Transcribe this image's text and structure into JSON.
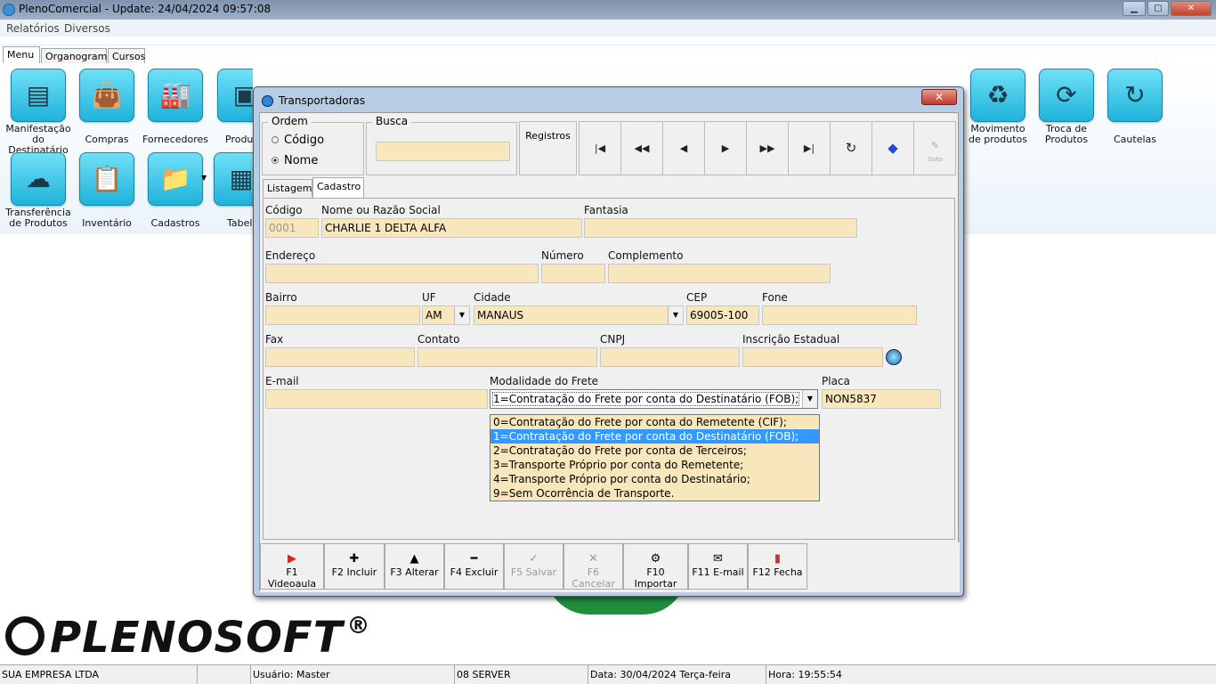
{
  "window": {
    "title": "PlenoComercial - Update: 24/04/2024 09:57:08"
  },
  "menubar": [
    "Relatórios",
    "Diversos"
  ],
  "main_tabs": [
    "Menu",
    "Organograma",
    "Cursos"
  ],
  "tiles": [
    {
      "label": "Manifestação do Destinatário",
      "icon": "document-check-icon"
    },
    {
      "label": "Compras",
      "icon": "shopping-bag-icon"
    },
    {
      "label": "Fornecedores",
      "icon": "factory-icon"
    },
    {
      "label": "Produt",
      "icon": "box-icon"
    },
    {
      "label": "Movimento de produtos",
      "icon": "recycle-icon"
    },
    {
      "label": "Troca de Produtos",
      "icon": "exchange-icon"
    },
    {
      "label": "Cautelas",
      "icon": "cycle-icon"
    },
    {
      "label": "Transferência de Produtos",
      "icon": "cloud-upload-icon"
    },
    {
      "label": "Inventário",
      "icon": "clipboard-check-icon"
    },
    {
      "label": "Cadastros",
      "icon": "folder-icon"
    },
    {
      "label": "Tabel",
      "icon": "table-icon"
    }
  ],
  "logo": {
    "text": "PLENOSOFT",
    "reg": "®"
  },
  "status": {
    "empresa": "SUA EMPRESA LTDA",
    "usuario": "Usuário: Master",
    "server": "08 SERVER",
    "data": "Data: 30/04/2024 Terça-feira",
    "hora": "Hora: 19:55:54"
  },
  "dialog": {
    "title": "Transportadoras",
    "ordem": {
      "label": "Ordem",
      "options": [
        "Código",
        "Nome"
      ],
      "selected": "Nome"
    },
    "busca": {
      "label": "Busca",
      "value": ""
    },
    "registros": "Registros",
    "nav_icons": [
      "first-record-icon",
      "prev-page-icon",
      "prev-record-icon",
      "next-record-icon",
      "next-page-icon",
      "last-record-icon",
      "refresh-icon",
      "tag-icon",
      "goto-icon"
    ],
    "goto_label": "Goto",
    "tabs": [
      "Listagem",
      "Cadastro"
    ],
    "active_tab": "Cadastro",
    "form": {
      "codigo": {
        "label": "Código",
        "value": "0001"
      },
      "nome": {
        "label": "Nome ou Razão Social",
        "value": "CHARLIE 1 DELTA ALFA"
      },
      "fantasia": {
        "label": "Fantasia",
        "value": ""
      },
      "endereco": {
        "label": "Endereço",
        "value": ""
      },
      "numero": {
        "label": "Número",
        "value": ""
      },
      "complemento": {
        "label": "Complemento",
        "value": ""
      },
      "bairro": {
        "label": "Bairro",
        "value": ""
      },
      "uf": {
        "label": "UF",
        "value": "AM"
      },
      "cidade": {
        "label": "Cidade",
        "value": "MANAUS"
      },
      "cep": {
        "label": "CEP",
        "value": "69005-100"
      },
      "fone": {
        "label": "Fone",
        "value": ""
      },
      "fax": {
        "label": "Fax",
        "value": ""
      },
      "contato": {
        "label": "Contato",
        "value": ""
      },
      "cnpj": {
        "label": "CNPJ",
        "value": ""
      },
      "ie": {
        "label": "Inscrição Estadual",
        "value": ""
      },
      "email": {
        "label": "E-mail",
        "value": ""
      },
      "modalidade": {
        "label": "Modalidade do Frete",
        "value": "1=Contratação do Frete por conta do Destinatário (FOB);"
      },
      "placa": {
        "label": "Placa",
        "value": "NON5837"
      }
    },
    "frete_options": [
      "0=Contratação do Frete por conta do Remetente (CIF);",
      "1=Contratação do Frete por conta do Destinatário (FOB);",
      "2=Contratação do Frete por conta de Terceiros;",
      "3=Transporte Próprio por conta do Remetente;",
      "4=Transporte Próprio por conta do Destinatário;",
      "9=Sem Ocorrência de Transporte."
    ],
    "frete_selected_index": 1,
    "buttons": [
      {
        "label": "F1 Videoaula",
        "icon": "youtube-icon",
        "enabled": true
      },
      {
        "label": "F2 Incluir",
        "icon": "plus-icon",
        "enabled": true
      },
      {
        "label": "F3 Alterar",
        "icon": "triangle-up-icon",
        "enabled": true
      },
      {
        "label": "F4 Excluir",
        "icon": "minus-icon",
        "enabled": true
      },
      {
        "label": "F5 Salvar",
        "icon": "check-icon",
        "enabled": false
      },
      {
        "label": "F6 Cancelar",
        "icon": "cancel-icon",
        "enabled": false
      },
      {
        "label": "F10 Importar",
        "icon": "import-icon",
        "enabled": true
      },
      {
        "label": "F11 E-mail",
        "icon": "envelope-icon",
        "enabled": true
      },
      {
        "label": "F12 Fecha",
        "icon": "exit-door-icon",
        "enabled": true
      }
    ]
  }
}
